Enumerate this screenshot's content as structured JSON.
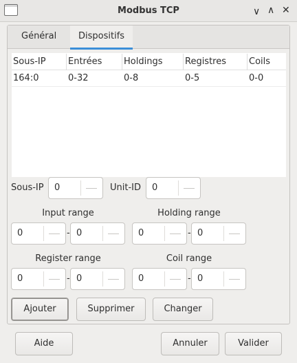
{
  "window": {
    "title": "Modbus TCP"
  },
  "tabs": [
    {
      "label": "Général"
    },
    {
      "label": "Dispositifs"
    }
  ],
  "table": {
    "columns": [
      "Sous-IP",
      "Entrées",
      "Holdings",
      "Registres",
      "Coils"
    ],
    "rows": [
      [
        "164:0",
        "0-32",
        "0-8",
        "0-5",
        "0-0"
      ]
    ]
  },
  "form": {
    "sous_ip_label": "Sous-IP",
    "sous_ip_value": "0",
    "unit_id_label": "Unit-ID",
    "unit_id_value": "0",
    "input_range_label": "Input range",
    "input_from": "0",
    "input_to": "0",
    "holding_range_label": "Holding range",
    "holding_from": "0",
    "holding_to": "0",
    "register_range_label": "Register range",
    "register_from": "0",
    "register_to": "0",
    "coil_range_label": "Coil range",
    "coil_from": "0",
    "coil_to": "0",
    "range_separator": "-"
  },
  "actions": {
    "add": "Ajouter",
    "delete": "Supprimer",
    "change": "Changer"
  },
  "footer": {
    "help": "Aide",
    "cancel": "Annuler",
    "ok": "Valider"
  },
  "icons": [
    "window-icon",
    "minimize-icon",
    "maximize-icon",
    "close-icon"
  ],
  "colors": {
    "accent": "#3b8ed8"
  }
}
